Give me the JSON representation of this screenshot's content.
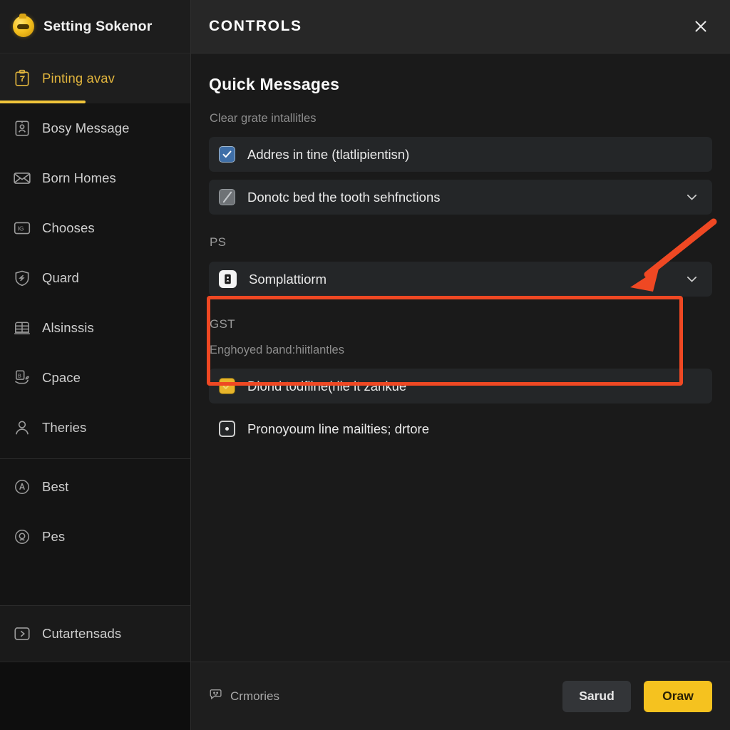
{
  "sidebar": {
    "brand": {
      "title": "Setting Sokenor",
      "icon": "app-logo-icon"
    },
    "items": [
      {
        "label": "Pinting avav",
        "icon": "clipboard-icon",
        "active": true
      },
      {
        "label": "Bosy Message",
        "icon": "device-icon",
        "active": false
      },
      {
        "label": "Born Homes",
        "icon": "envelope-icon",
        "active": false
      },
      {
        "label": "Chooses",
        "icon": "id-card-icon",
        "active": false
      },
      {
        "label": "Quard",
        "icon": "shield-icon",
        "active": false
      },
      {
        "label": "Alsinssis",
        "icon": "grid-panel-icon",
        "active": false
      },
      {
        "label": "Cpace",
        "icon": "hand-card-icon",
        "active": false
      },
      {
        "label": "Theries",
        "icon": "user-icon",
        "active": false
      }
    ],
    "bottom_items": [
      {
        "label": "Best",
        "icon": "circle-info-icon"
      },
      {
        "label": "Pes",
        "icon": "circle-clock-icon"
      }
    ],
    "collapse_item": {
      "label": "Cutartensads",
      "icon": "chevron-right-box-icon"
    }
  },
  "panel": {
    "title": "CONTROLS",
    "close_icon": "close-icon",
    "section_title": "Quick Messages",
    "caption": "Clear grate intallitles",
    "groups": [
      {
        "label": "",
        "rows": [
          {
            "text": "Addres in tine (tlatlipientisn)",
            "control": "checkbox-checked-blue",
            "shaded": true,
            "chevron": false
          },
          {
            "text": "Donotc bed the tooth sehfnctions",
            "control": "checkbox-slash-gray",
            "shaded": true,
            "chevron": true
          }
        ]
      },
      {
        "label": "PS",
        "rows": [
          {
            "text": "Somplattiorm",
            "control": "badge-white-icon",
            "shaded": true,
            "chevron": true
          }
        ]
      },
      {
        "label": "GST",
        "caption": "Enghoyed band:hiitlantles",
        "rows": [
          {
            "text": "Diond todfiine(rile it zankue",
            "control": "checkbox-checked-amber",
            "shaded": true,
            "chevron": false
          },
          {
            "text": "Pronoyoum line mailties; drtore",
            "control": "radio-dot-square",
            "shaded": false,
            "chevron": false
          }
        ]
      }
    ]
  },
  "footer": {
    "left_icon": "message-face-icon",
    "left_label": "Crmories",
    "secondary_button": "Sarud",
    "primary_button": "Oraw"
  },
  "annotation": {
    "highlight_color": "#ef4823",
    "arrow_icon": "red-arrow-icon"
  },
  "colors": {
    "accent": "#f5c21f",
    "active_text": "#e2b53d",
    "checkbox_blue": "#3f6fa8",
    "checkbox_amber": "#e8b52a",
    "highlight_red": "#ef4823",
    "panel_bg": "#1a1a1a",
    "sidebar_bg": "#141414"
  }
}
